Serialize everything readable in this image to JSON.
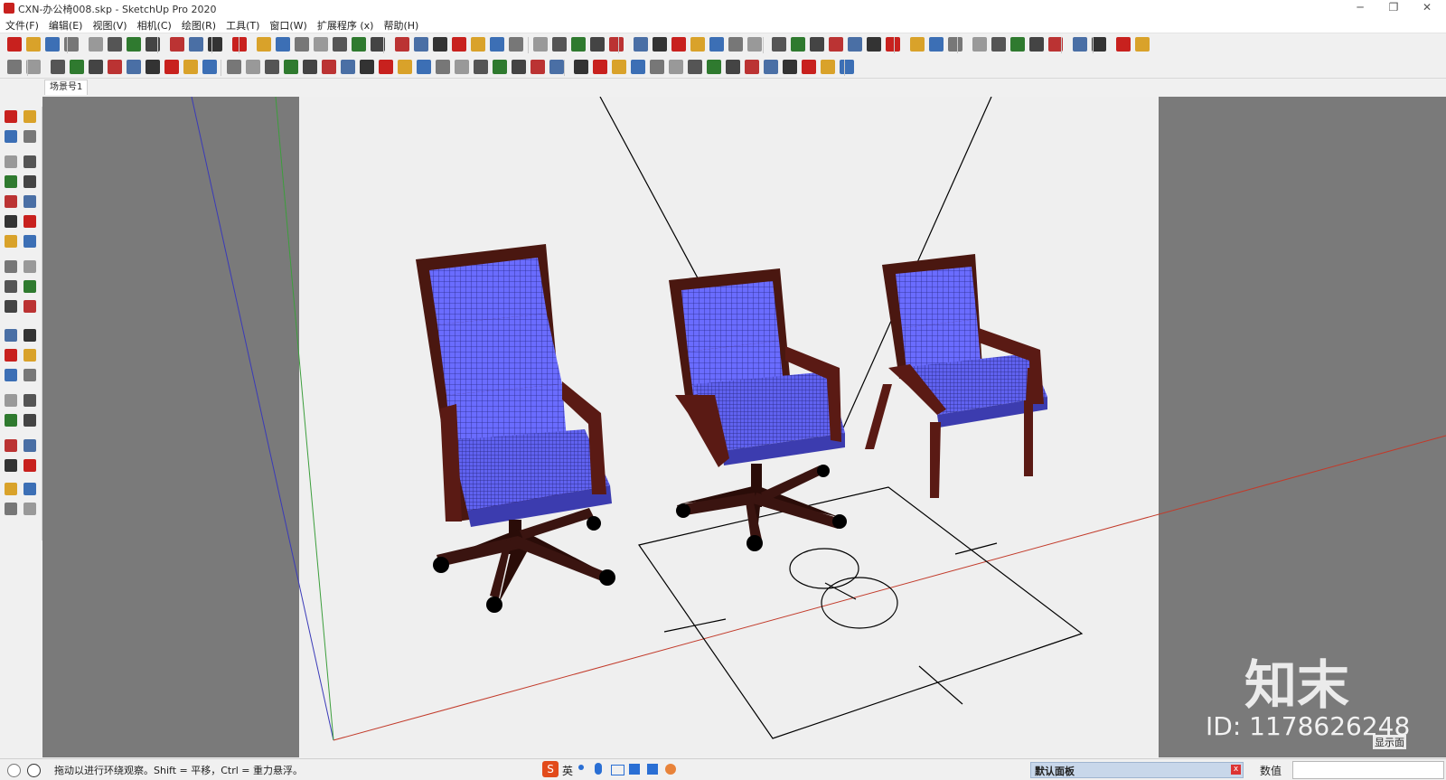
{
  "app": {
    "title": "CXN-办公椅008.skp - SketchUp Pro 2020"
  },
  "menu": [
    "文件(F)",
    "编辑(E)",
    "视图(V)",
    "相机(C)",
    "绘图(R)",
    "工具(T)",
    "窗口(W)",
    "扩展程序 (x)",
    "帮助(H)"
  ],
  "scene_tabs": [
    "场景号1"
  ],
  "status": {
    "message": "拖动以进行环绕观察。Shift = 平移，Ctrl = 重力悬浮。",
    "panel_title": "默认面板",
    "measurements_label": "数值",
    "ime_lang": "英"
  },
  "watermark": {
    "brand": "知末",
    "id_text": "ID: 1178626248",
    "corner_label": "显示面"
  },
  "colors": {
    "viewport_bg": "#7a7a7a",
    "canvas_bg": "#efefef",
    "seat_fabric": "#6a6cff",
    "wood_frame": "#5a1a14",
    "axis_red": "#c23a2a",
    "axis_green": "#3c9e3c",
    "axis_blue": "#3a3ab8"
  }
}
